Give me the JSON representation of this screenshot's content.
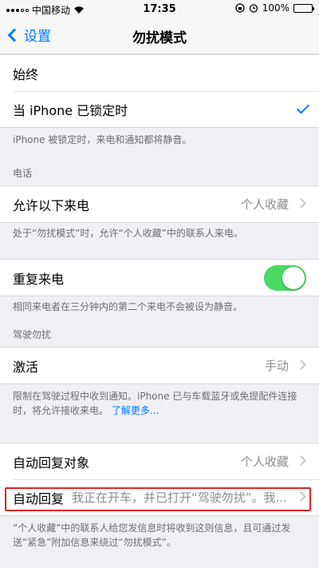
{
  "status_bar": {
    "carrier": "中国移动",
    "time": "17:35",
    "battery": "100%"
  },
  "nav": {
    "back_label": "设置",
    "title": "勿扰模式"
  },
  "silence": {
    "always_label": "始终",
    "locked_label": "当 iPhone 已锁定时",
    "footnote": "iPhone 被锁定时，来电和通知都将静音。"
  },
  "phone": {
    "header": "电话",
    "allow_calls_label": "允许以下来电",
    "allow_calls_value": "个人收藏",
    "footnote": "处于“勿扰模式”时，允许“个人收藏”中的联系人来电。",
    "repeated_calls_label": "重复来电",
    "repeated_calls_on": true,
    "repeated_footnote": "相同来电者在三分钟内的第二个来电不会被设为静音。"
  },
  "driving": {
    "header": "驾驶勿扰",
    "activate_label": "激活",
    "activate_value": "手动",
    "footnote": "限制在驾驶过程中收到通知。iPhone 已与车载蓝牙或免提配件连接时，将允许接收来电。",
    "learn_more": "了解更多...",
    "auto_reply_to_label": "自动回复对象",
    "auto_reply_to_value": "个人收藏",
    "auto_reply_label": "自动回复",
    "auto_reply_value": "我正在开车，并已打开“驾驶勿扰”。我...",
    "auto_reply_footnote": "“个人收藏”中的联系人给您发信息时将收到这则信息，且可通过发送“紧急”附加信息来绕过“勿扰模式”。"
  },
  "colors": {
    "accent": "#007aff",
    "toggle_on": "#4cd964",
    "highlight_box": "#e02424"
  }
}
